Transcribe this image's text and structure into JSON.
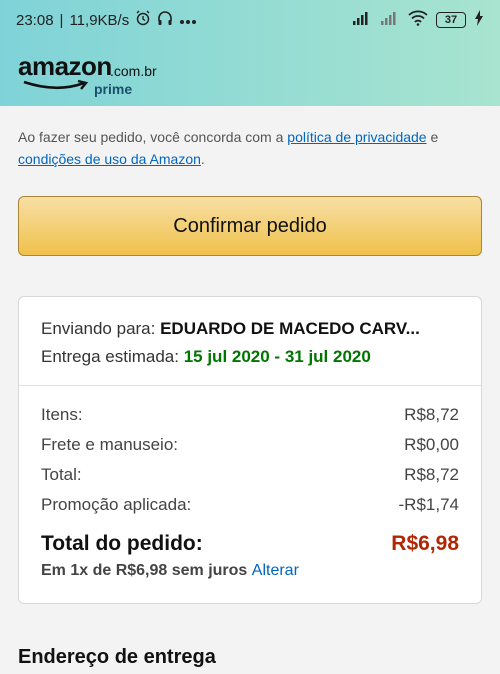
{
  "status_bar": {
    "time": "23:08",
    "speed": "11,9KB/s",
    "battery": "37",
    "icons": [
      "alarm-icon",
      "headphones-icon",
      "more-icon",
      "signal-icon",
      "wifi-icon",
      "battery-icon",
      "charging-icon"
    ]
  },
  "header": {
    "logo_main": "amazon",
    "logo_domain": ".com.br",
    "logo_sub": "prime"
  },
  "terms": {
    "prefix": "Ao fazer seu pedido, você concorda com a ",
    "privacy_link": "política de privacidade",
    "middle": " e ",
    "conditions_link": "condições de uso da Amazon",
    "suffix": "."
  },
  "confirm_button": "Confirmar pedido",
  "shipping": {
    "to_label": "Enviando para: ",
    "to_name": "EDUARDO DE MACEDO CARV...",
    "estimate_label": "Entrega estimada: ",
    "estimate_dates": "15 jul 2020 - 31 jul 2020"
  },
  "summary": {
    "rows": [
      {
        "label": "Itens:",
        "value": "R$8,72"
      },
      {
        "label": "Frete e manuseio:",
        "value": "R$0,00"
      },
      {
        "label": "Total:",
        "value": "R$8,72"
      },
      {
        "label": "Promoção aplicada:",
        "value": "-R$1,74"
      }
    ],
    "total_label": "Total do pedido:",
    "total_value": "R$6,98",
    "installments_text": "Em 1x de R$6,98 sem juros ",
    "change_link": "Alterar"
  },
  "delivery_section_title": "Endereço de entrega",
  "colors": {
    "header_gradient_start": "#7fd3d8",
    "header_gradient_end": "#a8e4cf",
    "button": "#f0c14b",
    "link": "#0066c0",
    "delivery_date": "#007600",
    "order_total": "#b12704"
  }
}
